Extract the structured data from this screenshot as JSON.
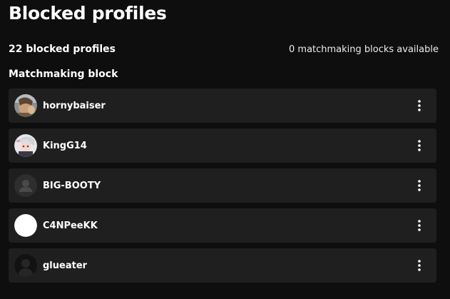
{
  "page_title": "Blocked profiles",
  "summary": {
    "blocked_count": "22 blocked profiles",
    "matchmaking_available": "0 matchmaking blocks available"
  },
  "section_title": "Matchmaking block",
  "profiles": [
    {
      "username": "hornybaiser",
      "avatar": "photo-avatar"
    },
    {
      "username": "KingG14",
      "avatar": "anime-avatar"
    },
    {
      "username": "BIG-BOOTY",
      "avatar": "default-avatar"
    },
    {
      "username": "C4NPeeKK",
      "avatar": "white-avatar"
    },
    {
      "username": "glueater",
      "avatar": "dark-avatar"
    }
  ],
  "row_menu_icon": "more-vertical-icon",
  "colors": {
    "background": "#0e0e0e",
    "row_background": "#1f1f1f",
    "text": "#ffffff"
  }
}
